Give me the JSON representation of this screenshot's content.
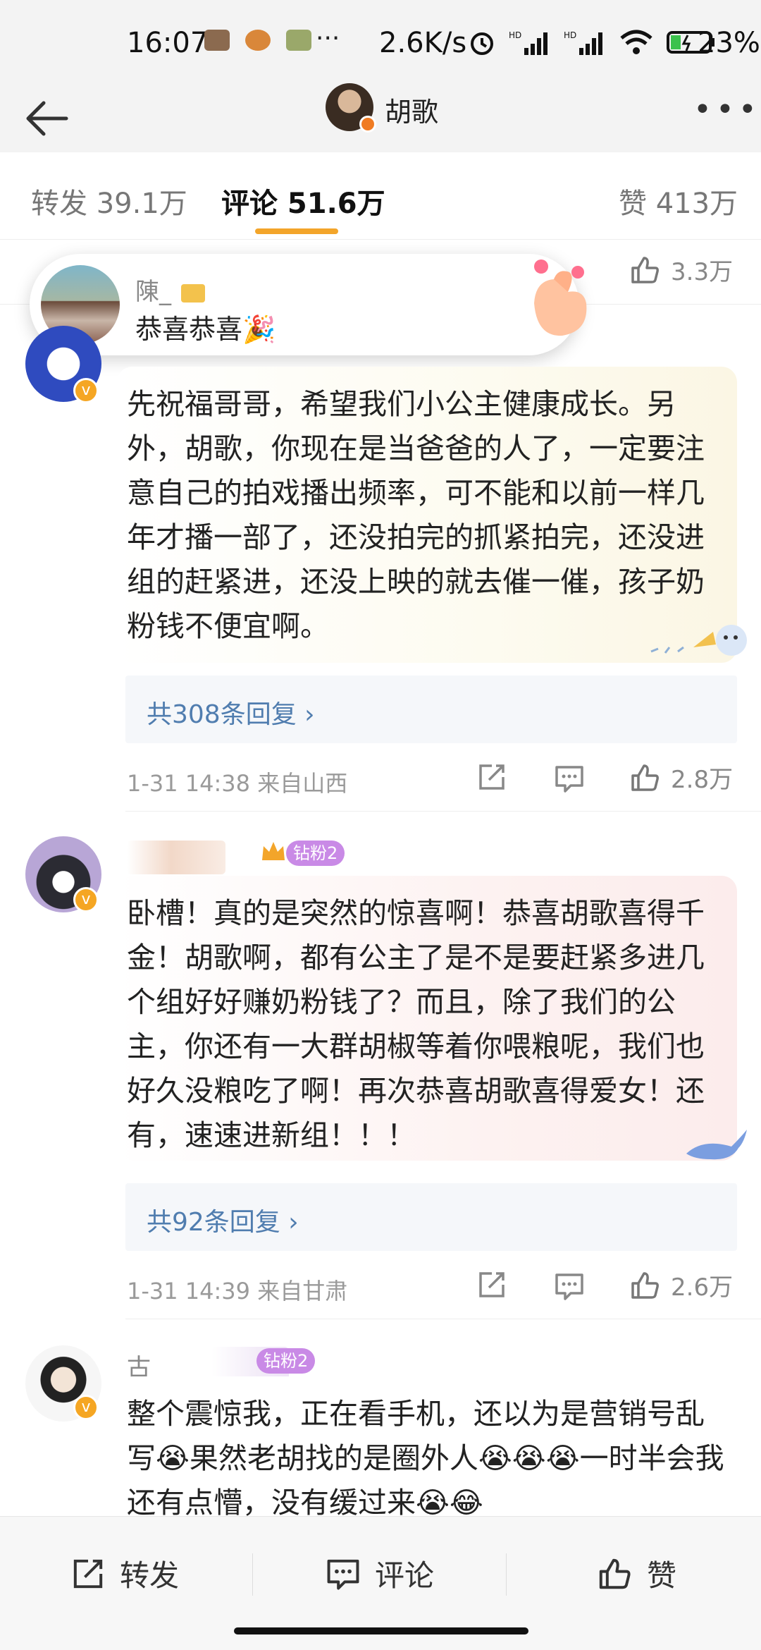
{
  "status_bar": {
    "time": "16:07",
    "more_dots": "···",
    "net_speed": "2.6K/s",
    "battery_pct": "23%"
  },
  "nav": {
    "back_icon": "back-arrow-icon",
    "title": "胡歌",
    "more_icon": "more-dots-icon"
  },
  "tabs": {
    "repost": "转发 39.1万",
    "comment": "评论 51.6万",
    "like": "赞 413万"
  },
  "prev_comment": {
    "like_count": "3.3万"
  },
  "toast": {
    "name": "陳_",
    "text": "恭喜恭喜🎉"
  },
  "comments": [
    {
      "text": "先祝福哥哥，希望我们小公主健康成长。另外，胡歌，你现在是当爸爸的人了，一定要注意自己的拍戏播出频率，可不能和以前一样几年才播一部了，还没拍完的抓紧拍完，还没进组的赶紧进，还没上映的就去催一催，孩子奶粉钱不便宜啊。",
      "replies": "共308条回复 ›",
      "meta": "1-31 14:38  来自山西",
      "like_count": "2.8万"
    },
    {
      "fan_badge": "钻粉2",
      "text": "卧槽！真的是突然的惊喜啊！恭喜胡歌喜得千金！胡歌啊，都有公主了是不是要赶紧多进几个组好好赚奶粉钱了？而且，除了我们的公主，你还有一大群胡椒等着你喂粮呢，我们也好久没粮吃了啊！再次恭喜胡歌喜得爱女！还有，速速进新组！！！",
      "replies": "共92条回复 ›",
      "meta": "1-31 14:39  来自甘肃",
      "like_count": "2.6万"
    },
    {
      "name_partial": "古",
      "fan_badge": "钻粉2",
      "text": "整个震惊我，正在看手机，还以为是营销号乱写😭果然老胡找的是圈外人😭😭😭一时半会我还有点懵，没有缓过来😭😂"
    }
  ],
  "bottom_bar": {
    "repost": "转发",
    "comment": "评论",
    "like": "赞"
  }
}
